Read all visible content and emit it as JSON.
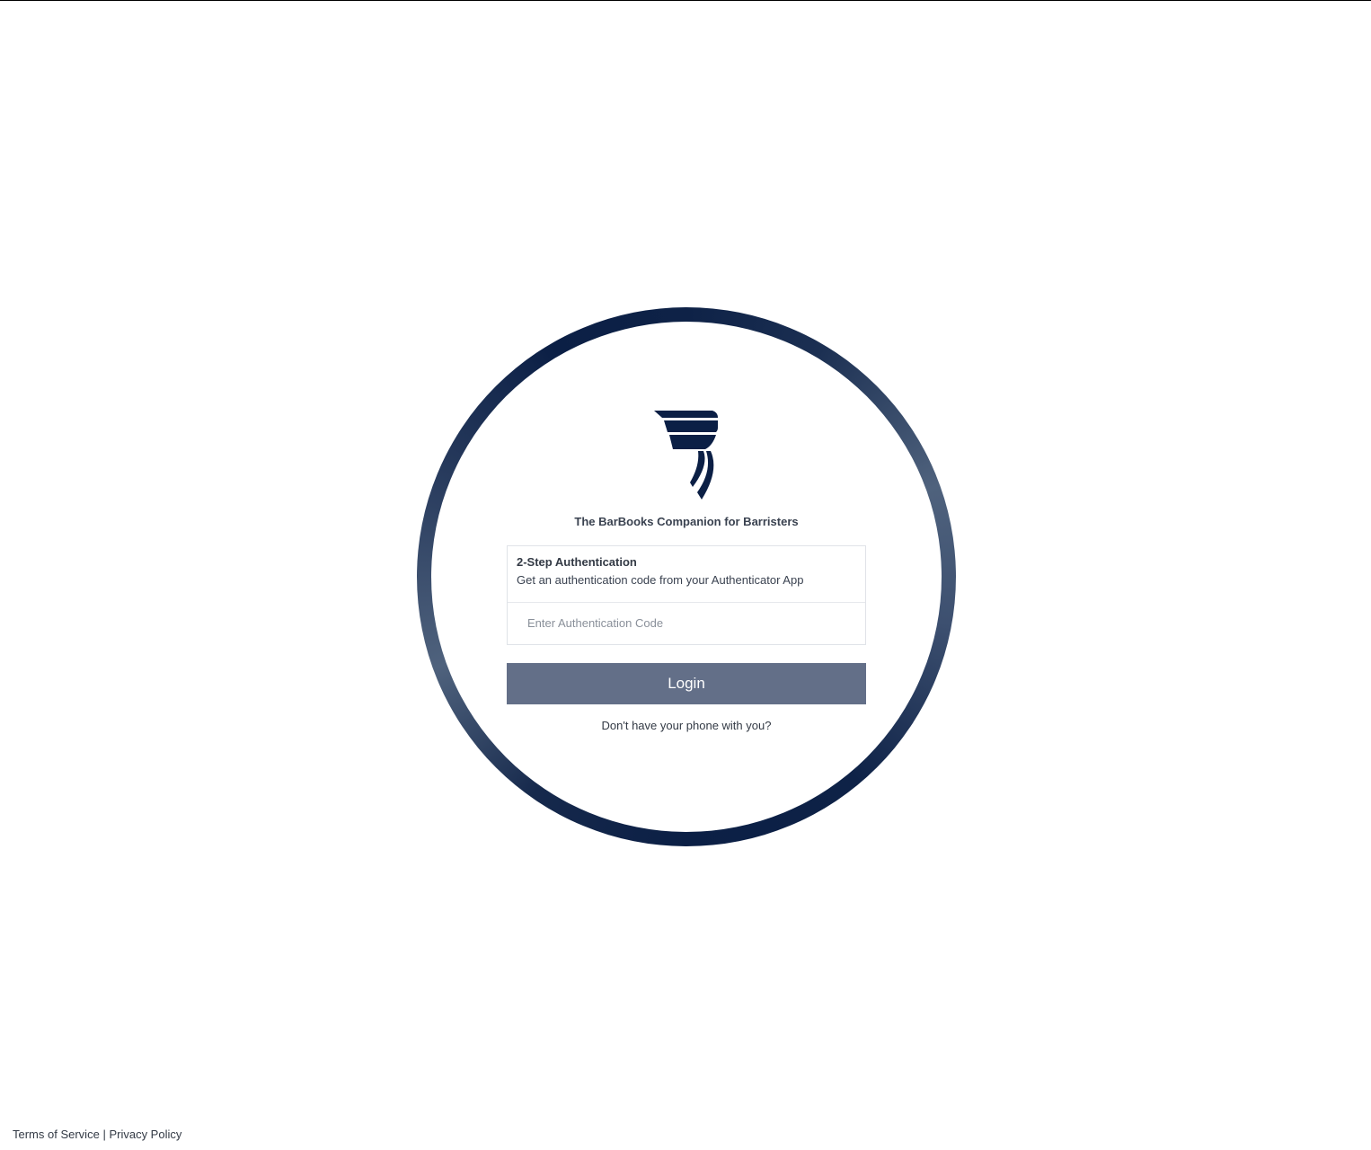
{
  "brand": {
    "tagline": "The BarBooks Companion for Barristers",
    "logo_icon": "barbooks-logo-icon",
    "navy": "#0b1f45"
  },
  "auth": {
    "title": "2-Step Authentication",
    "description": "Get an authentication code from your Authenticator App",
    "code_placeholder": "Enter Authentication Code",
    "code_value": ""
  },
  "actions": {
    "login_label": "Login",
    "login_color": "#636f88",
    "no_phone_label": "Don't have your phone with you?"
  },
  "footer": {
    "terms_label": "Terms of Service",
    "separator": "|",
    "privacy_label": "Privacy Policy"
  }
}
